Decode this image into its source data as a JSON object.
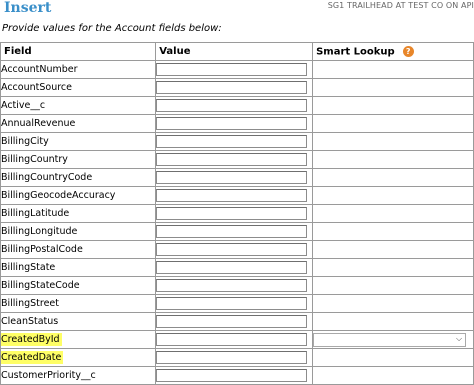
{
  "header": {
    "title": "Insert",
    "org": "SG1 TRAILHEAD AT TEST CO ON API"
  },
  "instruction": "Provide values for the Account fields below:",
  "table": {
    "columns": {
      "field": "Field",
      "value": "Value",
      "lookup": "Smart Lookup"
    },
    "help_icon_text": "?",
    "rows": [
      {
        "name": "AccountNumber"
      },
      {
        "name": "AccountSource"
      },
      {
        "name": "Active__c"
      },
      {
        "name": "AnnualRevenue"
      },
      {
        "name": "BillingCity"
      },
      {
        "name": "BillingCountry"
      },
      {
        "name": "BillingCountryCode"
      },
      {
        "name": "BillingGeocodeAccuracy"
      },
      {
        "name": "BillingLatitude"
      },
      {
        "name": "BillingLongitude"
      },
      {
        "name": "BillingPostalCode"
      },
      {
        "name": "BillingState"
      },
      {
        "name": "BillingStateCode"
      },
      {
        "name": "BillingStreet"
      },
      {
        "name": "CleanStatus"
      },
      {
        "name": "CreatedById",
        "highlighted": true,
        "lookup": "dropdown"
      },
      {
        "name": "CreatedDate",
        "highlighted": true
      },
      {
        "name": "CustomerPriority__c"
      }
    ]
  },
  "colors": {
    "title": "#3a8fc9",
    "highlight": "#ffff66",
    "help_icon": "#e8862a"
  },
  "icons": {
    "help": "help-icon",
    "dropdown": "chevron-down-icon"
  }
}
